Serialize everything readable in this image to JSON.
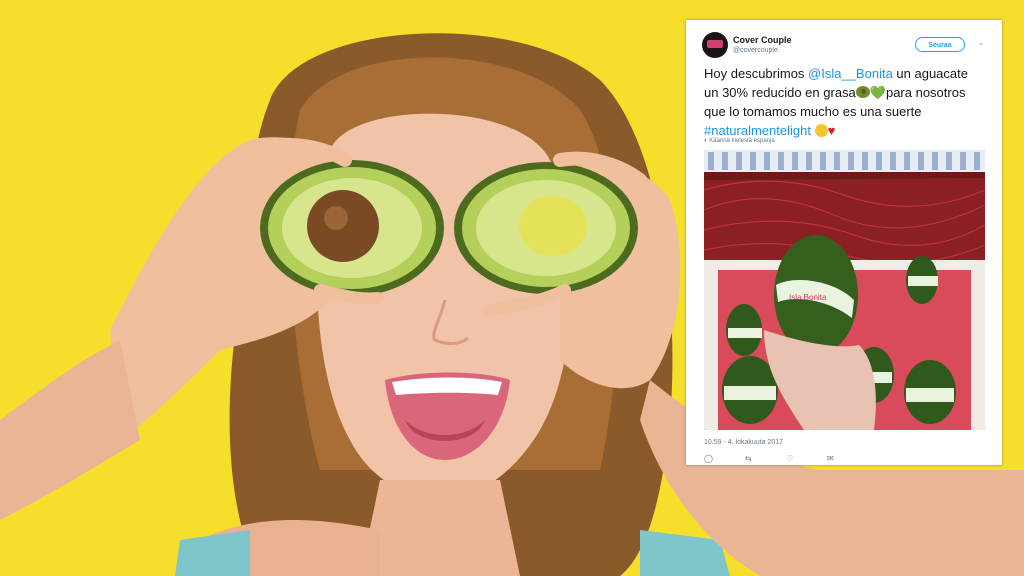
{
  "tweet": {
    "author_name": "Cover Couple",
    "author_handle": "@covercouple",
    "follow_label": "Seuraa",
    "text_part1": "Hoy descubrimos ",
    "mention": "@Isla__Bonita",
    "text_part2": " un aguacate un 30% reducido en grasa",
    "heart_green": "💚",
    "text_part3": "para nosotros que lo tomamos mucho es una suerte ",
    "hashtag": "#naturalmentelight",
    "heart_red": "♥",
    "translate_label": "Käännä kielestä espanja",
    "timestamp": "10.59 - 4. lokakuuta 2017",
    "action_icons": [
      "reply-icon",
      "retweet-icon",
      "like-icon",
      "message-icon"
    ],
    "media_label": "Isla Bonita"
  },
  "colors": {
    "background": "#f6df2a",
    "link": "#1b95e0",
    "avocado_skin": "#7c9b3a",
    "avocado_flesh": "#c9e07a"
  }
}
